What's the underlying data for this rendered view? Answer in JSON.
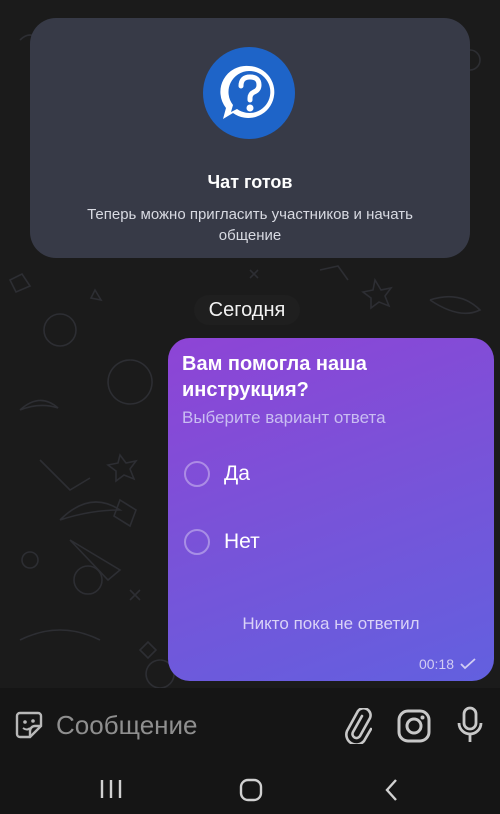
{
  "info_card": {
    "title": "Чат готов",
    "description": "Теперь можно пригласить участников и начать общение"
  },
  "date_separator": "Сегодня",
  "poll": {
    "question": "Вам помогла наша инструкция?",
    "hint": "Выберите вариант ответа",
    "options": [
      {
        "label": "Да"
      },
      {
        "label": "Нет"
      }
    ],
    "status": "Никто пока не ответил",
    "time": "00:18"
  },
  "composer": {
    "placeholder": "Сообщение"
  },
  "colors": {
    "card_bg": "#373a47",
    "poll_gradient_start": "#8e44d6",
    "poll_gradient_end": "#6260df",
    "logo_blue": "#1e64c8"
  },
  "icons": {
    "logo": "question-chat-logo-icon",
    "sticker": "sticker-icon",
    "attach": "paperclip-icon",
    "camera": "instagram-camera-icon",
    "voice": "microphone-icon",
    "read": "check-icon",
    "nav_recents": "recents-icon",
    "nav_home": "home-icon",
    "nav_back": "back-icon"
  }
}
